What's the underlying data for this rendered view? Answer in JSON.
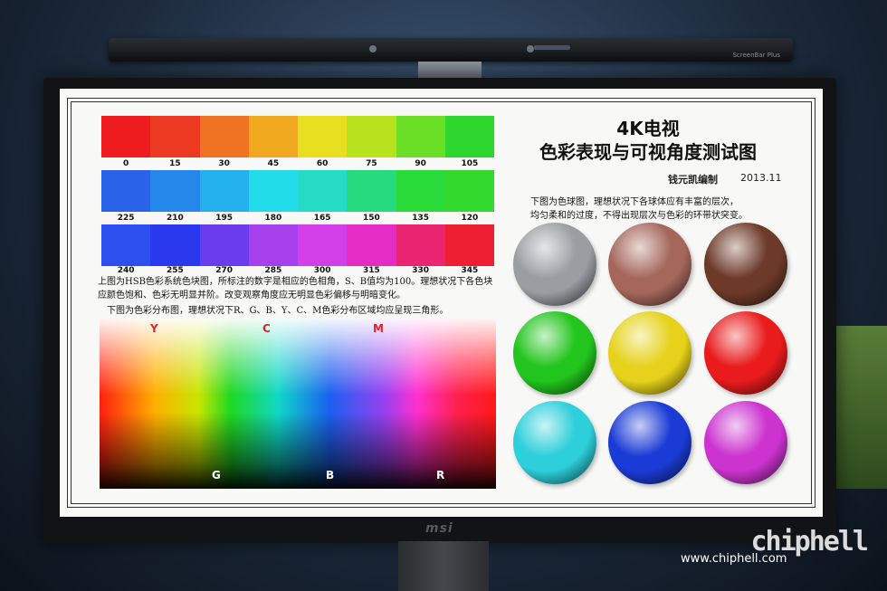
{
  "monitor_brand": "msi",
  "lightbar_brand": "ScreenBar Plus",
  "watermark": {
    "logo": "chiphell",
    "url": "www.chiphell.com"
  },
  "test_chart": {
    "title_line1": "4K电视",
    "title_line2": "色彩表现与可视角度测试图",
    "author": "钱元凯编制",
    "date": "2013.11",
    "strip1_labels": [
      "0",
      "15",
      "30",
      "45",
      "60",
      "75",
      "90",
      "105"
    ],
    "strip2_labels": [
      "225",
      "210",
      "195",
      "180",
      "165",
      "150",
      "135",
      "120"
    ],
    "strip3_labels": [
      "240",
      "255",
      "270",
      "285",
      "300",
      "315",
      "330",
      "345"
    ],
    "strip1_colors": [
      "#ee1b1f",
      "#ec3a22",
      "#ef7322",
      "#f0a91f",
      "#e8df21",
      "#b8e21d",
      "#6bdf25",
      "#2fd62d"
    ],
    "strip2_colors": [
      "#2a62e8",
      "#2687ea",
      "#22b1ec",
      "#22dbe9",
      "#25dbc6",
      "#26da80",
      "#2adc39",
      "#33d92d"
    ],
    "strip3_colors": [
      "#2d4ff0",
      "#2b39ee",
      "#6a3cee",
      "#a640ec",
      "#d23ee8",
      "#e32dc4",
      "#ea2470",
      "#ee1e33"
    ],
    "hsb_desc": "上图为HSB色彩系统色块图，所标注的数字是相应的色相角，S、B值均为100。理想状况下各色块应颜色饱和、色彩无明显并阶。改变观察角度应无明显色彩偏移与明暗变化。",
    "dist_desc": "下图为色彩分布图，理想状况下R、G、B、Y、C、M色彩分布区域均应呈现三角形。",
    "top_labels": [
      "Y",
      "C",
      "M"
    ],
    "bottom_labels": [
      "G",
      "B",
      "R"
    ],
    "sphere_desc_line1": "下图为色球图，理想状况下各球体应有丰富的层次，",
    "sphere_desc_line2": "均匀柔和的过度，不得出现层次与色彩的环带状突变。",
    "spheres": [
      {
        "name": "gray-sphere",
        "color": "#9a9ea3"
      },
      {
        "name": "skin-sphere",
        "color": "#a5675c"
      },
      {
        "name": "brown-sphere",
        "color": "#6d3a2a"
      },
      {
        "name": "green-sphere",
        "color": "#22c51d"
      },
      {
        "name": "yellow-sphere",
        "color": "#e6d21b"
      },
      {
        "name": "red-sphere",
        "color": "#e91b1d"
      },
      {
        "name": "cyan-sphere",
        "color": "#2ccfda"
      },
      {
        "name": "blue-sphere",
        "color": "#1b3bd6"
      },
      {
        "name": "magenta-sphere",
        "color": "#cc33cf"
      }
    ]
  }
}
